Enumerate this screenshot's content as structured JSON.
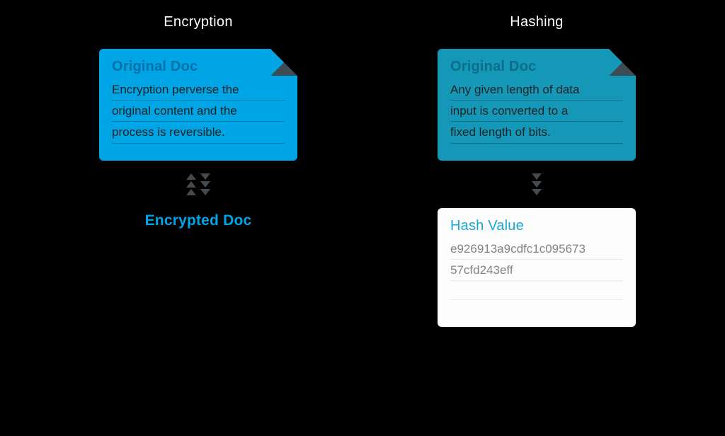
{
  "columns": {
    "left": {
      "title": "Encryption",
      "top_doc": {
        "title": "Original Doc",
        "line1": "Encryption perverse the",
        "line2": "original content and the",
        "line3": "process is reversible."
      },
      "arrow_bidirectional": true,
      "bottom_label": "Encrypted Doc"
    },
    "right": {
      "title": "Hashing",
      "top_doc": {
        "title": "Original Doc",
        "line1": "Any given length of data",
        "line2": "input is converted to a",
        "line3": "fixed length of bits."
      },
      "arrow_bidirectional": false,
      "bottom_doc": {
        "title": "Hash Value",
        "line1": "e926913a9cdfc1c095673",
        "line2": "57cfd243eff"
      }
    }
  }
}
